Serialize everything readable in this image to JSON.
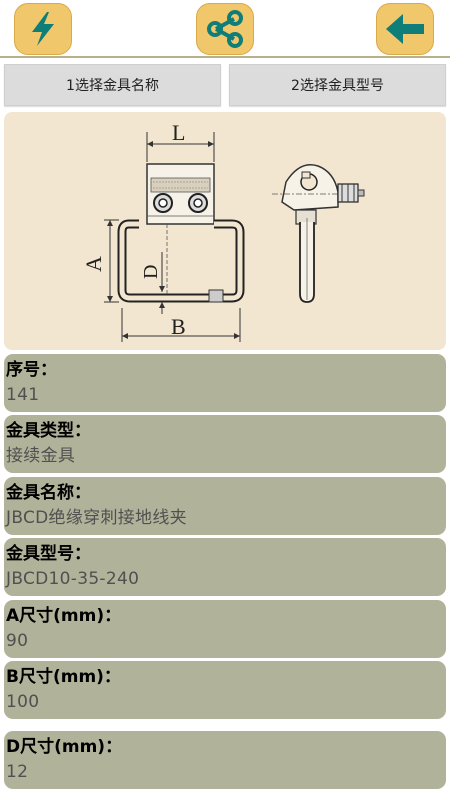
{
  "topbar": {
    "flash_icon": "lightning-icon",
    "share_icon": "share-icon",
    "back_icon": "arrow-left-icon"
  },
  "tabs": [
    {
      "label": "1选择金具名称"
    },
    {
      "label": "2选择金具型号"
    }
  ],
  "figure": {
    "dim_L": "L",
    "dim_A": "A",
    "dim_B": "B",
    "dim_D": "D"
  },
  "fields": [
    {
      "label": "序号：",
      "value": "141"
    },
    {
      "label": "金具类型：",
      "value": "接续金具"
    },
    {
      "label": "金具名称：",
      "value": "JBCD绝缘穿刺接地线夹"
    },
    {
      "label": "金具型号：",
      "value": "JBCD10-35-240"
    },
    {
      "label": "A尺寸(mm)：",
      "value": "90"
    },
    {
      "label": "B尺寸(mm)：",
      "value": "100"
    },
    {
      "label": "D尺寸(mm)：",
      "value": "12"
    }
  ],
  "colors": {
    "button_fill": "#f0c76a",
    "icon_teal": "#0f7d78",
    "card_bg": "#b0b39a",
    "figure_bg": "#f3e6d0"
  }
}
